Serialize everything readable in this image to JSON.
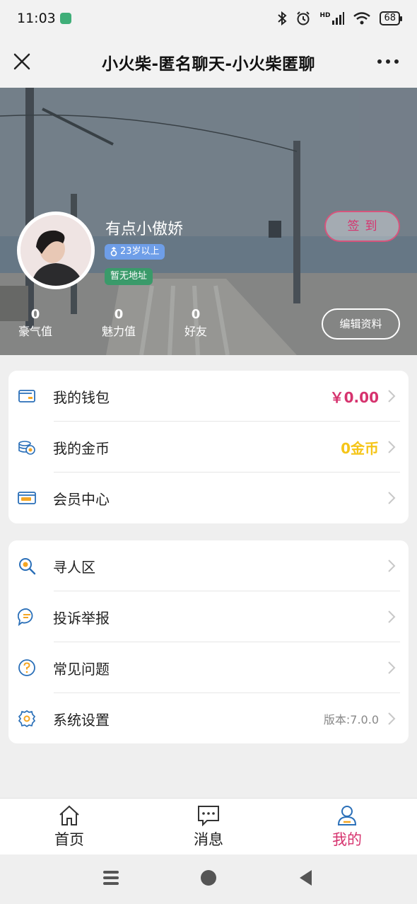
{
  "status_bar": {
    "time": "11:03",
    "network": "HD",
    "battery": "68"
  },
  "title_bar": {
    "title": "小火柴-匿名聊天-小火柴匿聊"
  },
  "profile": {
    "nickname": "有点小傲娇",
    "age_tag": "23岁以上",
    "address_tag": "暂无地址",
    "signin_label": "签到",
    "edit_label": "编辑资料",
    "stats": [
      {
        "value": "0",
        "label": "豪气值"
      },
      {
        "value": "0",
        "label": "魅力值"
      },
      {
        "value": "0",
        "label": "好友"
      }
    ]
  },
  "menu_group_1": [
    {
      "label": "我的钱包",
      "value": "￥0.00",
      "icon": "wallet-icon"
    },
    {
      "label": "我的金币",
      "value": "0金币",
      "icon": "coins-icon"
    },
    {
      "label": "会员中心",
      "value": "",
      "icon": "vip-card-icon"
    }
  ],
  "menu_group_2": [
    {
      "label": "寻人区",
      "value": "",
      "icon": "search-icon"
    },
    {
      "label": "投诉举报",
      "value": "",
      "icon": "chat-report-icon"
    },
    {
      "label": "常见问题",
      "value": "",
      "icon": "question-icon"
    },
    {
      "label": "系统设置",
      "value": "版本:7.0.0",
      "icon": "gear-icon"
    }
  ],
  "tabbar": {
    "items": [
      {
        "label": "首页",
        "icon": "home-icon"
      },
      {
        "label": "消息",
        "icon": "message-icon"
      },
      {
        "label": "我的",
        "icon": "user-icon",
        "active": true
      }
    ]
  },
  "colors": {
    "accent": "#d6336e",
    "gold": "#f5c518",
    "icon_blue": "#2a6fb8"
  }
}
